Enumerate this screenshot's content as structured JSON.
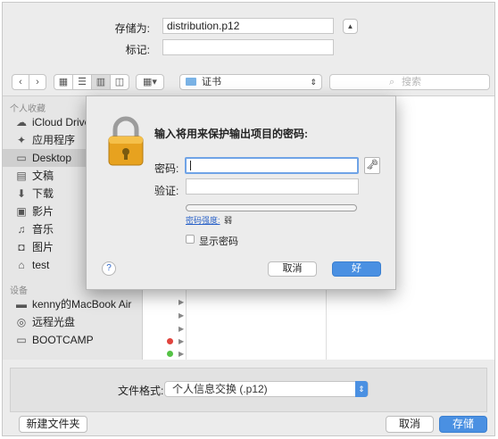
{
  "save_as": {
    "label": "存储为:",
    "value": "distribution.p12"
  },
  "tags": {
    "label": "标记:",
    "value": ""
  },
  "toolbar": {
    "location": "证书",
    "search_placeholder": "搜索"
  },
  "sidebar": {
    "favorites_header": "个人收藏",
    "favorites": [
      {
        "label": "iCloud Drive",
        "icon": "cloud-icon"
      },
      {
        "label": "应用程序",
        "icon": "applications-icon"
      },
      {
        "label": "Desktop",
        "icon": "desktop-icon",
        "selected": true
      },
      {
        "label": "文稿",
        "icon": "documents-icon"
      },
      {
        "label": "下载",
        "icon": "downloads-icon"
      },
      {
        "label": "影片",
        "icon": "movies-icon"
      },
      {
        "label": "音乐",
        "icon": "music-icon"
      },
      {
        "label": "图片",
        "icon": "pictures-icon"
      },
      {
        "label": "test",
        "icon": "home-icon"
      }
    ],
    "devices_header": "设备",
    "devices": [
      {
        "label": "kenny的MacBook Air",
        "icon": "laptop-icon"
      },
      {
        "label": "远程光盘",
        "icon": "disc-icon"
      },
      {
        "label": "BOOTCAMP",
        "icon": "drive-icon"
      }
    ]
  },
  "format": {
    "label": "文件格式:",
    "value": "个人信息交换 (.p12)"
  },
  "buttons": {
    "new_folder": "新建文件夹",
    "cancel": "取消",
    "save": "存储"
  },
  "password_dialog": {
    "title": "输入将用来保护输出项目的密码:",
    "password_label": "密码:",
    "password_value": "",
    "verify_label": "验证:",
    "verify_value": "",
    "strength_label": "密码强度:",
    "strength_value": "弱",
    "strength_level": 0,
    "show_password_label": "显示密码",
    "show_password_checked": false,
    "help": "?",
    "cancel": "取消",
    "ok": "好"
  },
  "colors": {
    "accent": "#4a90e2",
    "link": "#2a62c8",
    "tag_red": "#e0443e",
    "tag_green": "#55c246"
  }
}
